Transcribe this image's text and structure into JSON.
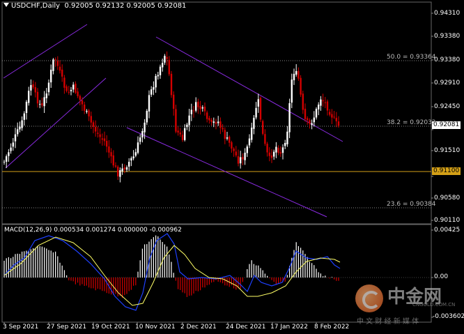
{
  "header": {
    "menu_icon": "triangle-down-icon",
    "symbol": "USDCHF,Daily",
    "ohlc": "0.92005 0.92132 0.92005 0.92081"
  },
  "price_axis": {
    "ticks": [
      "0.94310",
      "0.93380",
      "0.92910",
      "0.92450",
      "0.91980",
      "0.91510",
      "0.91050",
      "0.90580",
      "0.90110"
    ],
    "current_price": "0.92081",
    "horizontal_level": "0.91100"
  },
  "fib_labels": {
    "fib_50": "50.0 = 0.93364",
    "fib_38": "38.2 = 0.92032",
    "fib_23": "23.6 = 0.90384"
  },
  "macd": {
    "title": "MACD(12,26,9) 0.000534 0.001274 0.000000 -0.000962",
    "axis_top": "0.00425",
    "axis_zero": "0.00",
    "axis_bottom": "-0.003602"
  },
  "time_axis": [
    "3 Sep 2021",
    "27 Sep 2021",
    "19 Oct 2021",
    "10 Nov 2021",
    "2 Dec 2021",
    "24 Dec 2021",
    "17 Jan 2022",
    "8 Feb 2022"
  ],
  "watermark": {
    "logo_text": "中金网",
    "domain": "CNGOLD.COM.CN",
    "slogan": "中 文 财 经 新 媒 体"
  },
  "colors": {
    "background": "#000000",
    "bull_candle": "#ffffff",
    "bear_candle": "#d40000",
    "channel": "#8a2be2",
    "level_line": "#d4a017",
    "macd_line": "#1e40ff",
    "signal_line": "#ffff66",
    "hist_up": "#ffffff",
    "hist_down": "#d40000"
  }
}
